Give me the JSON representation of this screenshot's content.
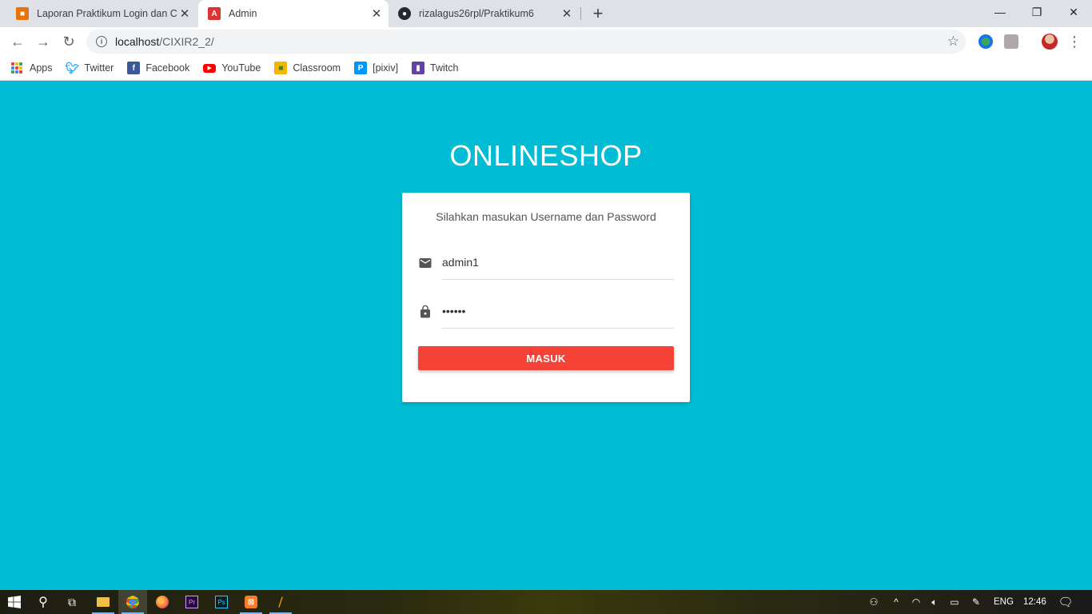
{
  "browser": {
    "tabs": [
      {
        "title": "Laporan Praktikum Login dan CRUD",
        "icon": "blogger-icon",
        "color": "#e8710a"
      },
      {
        "title": "Admin",
        "icon": "angular-icon",
        "color": "#dd3333"
      },
      {
        "title": "rizalagus26rpl/Praktikum6",
        "icon": "github-icon",
        "color": "#24292e"
      }
    ],
    "url_host": "localhost",
    "url_path": "/CIXIR2_2/",
    "bookmarks": [
      {
        "label": "Apps"
      },
      {
        "label": "Twitter",
        "color": "#1da1f2"
      },
      {
        "label": "Facebook",
        "color": "#3b5998"
      },
      {
        "label": "YouTube",
        "color": "#ff0000"
      },
      {
        "label": "Classroom",
        "color": "#f4b400"
      },
      {
        "label": "[pixiv]",
        "color": "#0096fa"
      },
      {
        "label": "Twitch",
        "color": "#6441a5"
      }
    ]
  },
  "page": {
    "brand": "ONLINESHOP",
    "background": "#00bcd4",
    "login": {
      "message": "Silahkan masukan Username dan Password",
      "username_value": "admin1",
      "password_value": "••••••",
      "submit_label": "MASUK",
      "submit_color": "#f44336"
    }
  },
  "taskbar": {
    "language": "ENG",
    "time": "12:46",
    "apps": [
      "start-icon",
      "search-icon",
      "task-view-icon",
      "file-explorer-icon",
      "chrome-icon",
      "firefox-icon",
      "premiere-icon",
      "photoshop-icon",
      "xampp-icon",
      "sublime-icon"
    ]
  }
}
